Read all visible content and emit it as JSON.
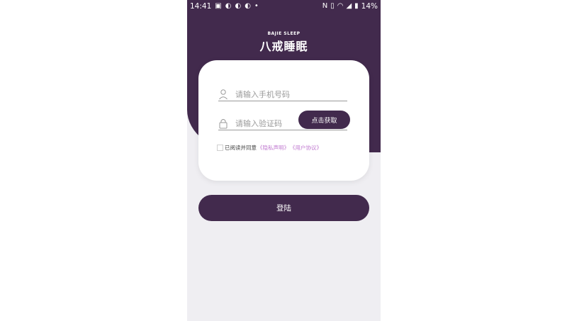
{
  "status_bar": {
    "time": "14:41",
    "battery": "14%",
    "left_icons": [
      "image-icon",
      "q-app-icon",
      "q-app-icon",
      "q-app-icon",
      "dot-icon"
    ],
    "right_icons": [
      "nfc-icon",
      "vibrate-icon",
      "wifi-icon",
      "no-signal-icon",
      "battery-icon"
    ]
  },
  "logo": {
    "subtitle": "BAJIE SLEEP",
    "title": "八戒睡眠"
  },
  "form": {
    "phone_placeholder": "请输入手机号码",
    "code_placeholder": "请输入验证码",
    "get_code_label": "点击获取",
    "agree_text": "已阅读并同意",
    "privacy_link": "《隐私声明》",
    "user_link": "《用户协议》"
  },
  "login_label": "登陆",
  "colors": {
    "primary": "#422a4d",
    "background": "#efeef2",
    "link": "#c07ad0"
  }
}
